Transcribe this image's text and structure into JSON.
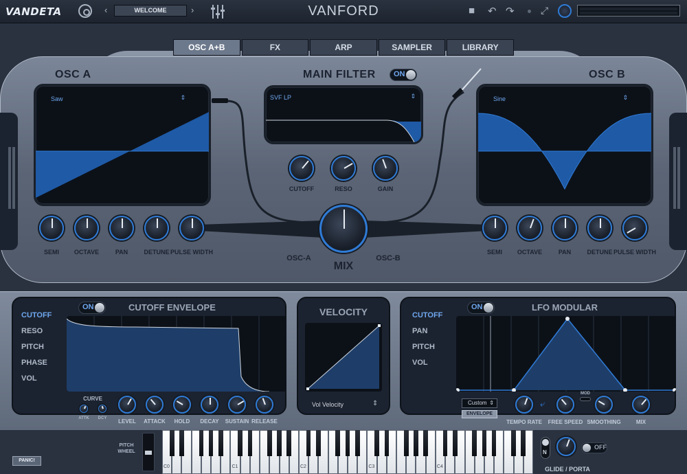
{
  "topbar": {
    "brand": "VANDETA",
    "preset": "WELCOME",
    "prev": "‹",
    "next": "›",
    "title": "VANFORD",
    "icons": [
      "gear-icon",
      "mixer-icon",
      "file-icon",
      "undo-icon",
      "redo-icon",
      "dot-icon",
      "expand-icon",
      "volume-knob"
    ]
  },
  "tabs": [
    {
      "label": "OSC A+B",
      "active": true
    },
    {
      "label": "FX",
      "active": false
    },
    {
      "label": "ARP",
      "active": false
    },
    {
      "label": "SAMPLER",
      "active": false
    },
    {
      "label": "LIBRARY",
      "active": false
    }
  ],
  "osc_a": {
    "title": "OSC A",
    "waveform": "Saw",
    "knobs": [
      "SEMI",
      "OCTAVE",
      "PAN",
      "DETUNE",
      "PULSE WIDTH"
    ]
  },
  "osc_b": {
    "title": "OSC B",
    "waveform": "Sine",
    "knobs": [
      "SEMI",
      "OCTAVE",
      "PAN",
      "DETUNE",
      "PULSE WIDTH"
    ]
  },
  "main_filter": {
    "title": "MAIN FILTER",
    "toggle": "ON",
    "type": "SVF LP",
    "knobs": [
      "CUTOFF",
      "RESO",
      "GAIN"
    ]
  },
  "mix": {
    "label": "MIX",
    "left": "OSC-A",
    "right": "OSC-B"
  },
  "cutoff_envelope": {
    "title": "CUTOFF ENVELOPE",
    "toggle": "ON",
    "targets": [
      {
        "label": "CUTOFF",
        "active": true
      },
      {
        "label": "RESO",
        "active": false
      },
      {
        "label": "PITCH",
        "active": false
      },
      {
        "label": "PHASE",
        "active": false
      },
      {
        "label": "VOL",
        "active": false
      }
    ],
    "curve_label": "CURVE",
    "curve_knobs": [
      "ATTK",
      "DCY"
    ],
    "knobs": [
      "LEVEL",
      "ATTACK",
      "HOLD",
      "DECAY",
      "SUSTAIN",
      "RELEASE"
    ]
  },
  "velocity": {
    "title": "VELOCITY",
    "select": "Vol Velocity"
  },
  "lfo": {
    "title": "LFO MODULAR",
    "toggle": "ON",
    "targets": [
      {
        "label": "CUTOFF",
        "active": true
      },
      {
        "label": "PAN",
        "active": false
      },
      {
        "label": "PITCH",
        "active": false
      },
      {
        "label": "VOL",
        "active": false
      }
    ],
    "shape_select": "Custom",
    "envelope_button": "ENVELOPE",
    "mod_label": "MOD",
    "knobs": [
      "TEMPO RATE",
      "FREE SPEED",
      "SMOOTHING",
      "MIX"
    ]
  },
  "keyboard": {
    "pitch_wheel": "PITCH\nWHEEL",
    "octave_labels": [
      "C0",
      "C1",
      "C2",
      "C3",
      "C4"
    ],
    "glide_label": "GLIDE / PORTA",
    "glide_toggle": "OFF",
    "mono_label": "N"
  },
  "panic_button": "PANIC!",
  "colors": {
    "accent": "#2f7bd6",
    "highlight": "#6fa7ee",
    "panel": "#6b7688",
    "screen": "#0c1118"
  }
}
